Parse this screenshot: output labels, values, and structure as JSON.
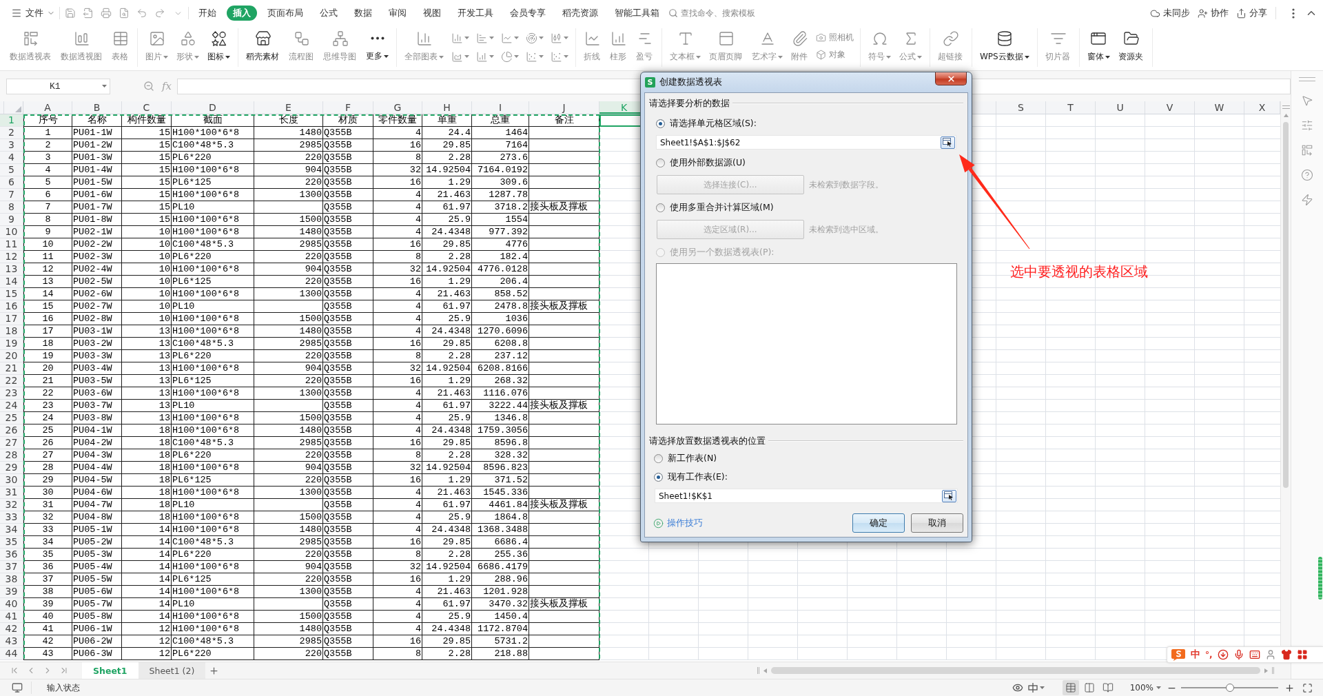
{
  "menu": {
    "file": "文件",
    "tabs": [
      {
        "label": "开始",
        "selected": false
      },
      {
        "label": "插入",
        "selected": true
      },
      {
        "label": "页面布局",
        "selected": false
      },
      {
        "label": "公式",
        "selected": false
      },
      {
        "label": "数据",
        "selected": false
      },
      {
        "label": "审阅",
        "selected": false
      },
      {
        "label": "视图",
        "selected": false
      },
      {
        "label": "开发工具",
        "selected": false
      },
      {
        "label": "会员专享",
        "selected": false
      },
      {
        "label": "稻壳资源",
        "selected": false
      },
      {
        "label": "智能工具箱",
        "selected": false
      }
    ],
    "search": "查找命令、搜索模板",
    "actions": [
      {
        "kind": "sync",
        "label": "未同步"
      },
      {
        "kind": "collaborate",
        "label": "协作"
      },
      {
        "kind": "share",
        "label": "分享"
      }
    ]
  },
  "ribbon": [
    {
      "items": [
        {
          "kind": "large",
          "label": "数据透视表",
          "dropdown": false,
          "disabled": true
        },
        {
          "kind": "large",
          "label": "数据透视图",
          "dropdown": false,
          "disabled": true
        },
        {
          "kind": "large",
          "label": "表格",
          "dropdown": false,
          "disabled": true
        }
      ]
    },
    {
      "items": [
        {
          "kind": "large",
          "label": "图片",
          "dropdown": true,
          "disabled": true
        },
        {
          "kind": "large",
          "label": "形状",
          "dropdown": true,
          "disabled": true
        },
        {
          "kind": "large",
          "label": "图标",
          "dropdown": true,
          "disabled": false
        }
      ]
    },
    {
      "items": [
        {
          "kind": "large",
          "label": "稻壳素材",
          "dropdown": false,
          "disabled": false
        },
        {
          "kind": "large",
          "label": "流程图",
          "dropdown": false,
          "disabled": true
        },
        {
          "kind": "large",
          "label": "思维导图",
          "dropdown": false,
          "disabled": true
        },
        {
          "kind": "large",
          "label": "更多",
          "dropdown": true,
          "disabled": false
        }
      ]
    },
    {
      "items": [
        {
          "kind": "large",
          "label": "全部图表",
          "dropdown": true,
          "disabled": true
        },
        {
          "kind": "grid",
          "buttons": [
            {
              "dropdown": true,
              "disabled": true
            },
            {
              "dropdown": true,
              "disabled": true
            },
            {
              "dropdown": true,
              "disabled": true
            },
            {
              "dropdown": true,
              "disabled": true
            },
            {
              "dropdown": true,
              "disabled": true
            },
            {
              "dropdown": true,
              "disabled": true
            },
            {
              "dropdown": true,
              "disabled": true
            },
            {
              "dropdown": true,
              "disabled": true
            },
            {
              "dropdown": true,
              "disabled": true
            },
            {
              "dropdown": true,
              "disabled": true
            }
          ]
        }
      ]
    },
    {
      "items": [
        {
          "kind": "large",
          "label": "折线",
          "dropdown": false,
          "disabled": true
        },
        {
          "kind": "large",
          "label": "柱形",
          "dropdown": false,
          "disabled": true
        },
        {
          "kind": "large",
          "label": "盈亏",
          "dropdown": false,
          "disabled": true
        }
      ]
    },
    {
      "items": [
        {
          "kind": "large",
          "label": "文本框",
          "dropdown": true,
          "disabled": true
        },
        {
          "kind": "large",
          "label": "页眉页脚",
          "dropdown": false,
          "disabled": true
        },
        {
          "kind": "large",
          "label": "艺术字",
          "dropdown": true,
          "disabled": true
        },
        {
          "kind": "large",
          "label": "附件",
          "dropdown": false,
          "disabled": true
        },
        {
          "kind": "stack",
          "buttons": [
            {
              "label": "照相机",
              "disabled": true
            },
            {
              "label": "对象",
              "disabled": true
            }
          ]
        }
      ]
    },
    {
      "items": [
        {
          "kind": "large",
          "label": "符号",
          "dropdown": true,
          "disabled": true
        },
        {
          "kind": "large",
          "label": "公式",
          "dropdown": true,
          "disabled": true
        }
      ]
    },
    {
      "items": [
        {
          "kind": "large",
          "label": "超链接",
          "dropdown": false,
          "disabled": true
        }
      ]
    },
    {
      "items": [
        {
          "kind": "large",
          "label": "WPS云数据",
          "dropdown": true,
          "disabled": false
        }
      ]
    },
    {
      "items": [
        {
          "kind": "large",
          "label": "切片器",
          "dropdown": false,
          "disabled": true
        }
      ]
    },
    {
      "items": [
        {
          "kind": "large",
          "label": "窗体",
          "dropdown": true,
          "disabled": false
        },
        {
          "kind": "large",
          "label": "资源夹",
          "dropdown": false,
          "disabled": false
        }
      ]
    }
  ],
  "sheet": {
    "name_box": "K1",
    "formula_label": "fx",
    "columns": [
      {
        "label": "A",
        "selected": false
      },
      {
        "label": "B",
        "selected": false
      },
      {
        "label": "C",
        "selected": false
      },
      {
        "label": "D",
        "selected": false
      },
      {
        "label": "E",
        "selected": false
      },
      {
        "label": "F",
        "selected": false
      },
      {
        "label": "G",
        "selected": false
      },
      {
        "label": "H",
        "selected": false
      },
      {
        "label": "I",
        "selected": false
      },
      {
        "label": "J",
        "selected": false
      },
      {
        "label": "K",
        "selected": true
      }
    ],
    "columns_right": [
      {
        "label": "S",
        "selected": false
      },
      {
        "label": "T",
        "selected": false
      },
      {
        "label": "U",
        "selected": false
      },
      {
        "label": "V",
        "selected": false
      },
      {
        "label": "W",
        "selected": false
      },
      {
        "label": "X",
        "selected": false
      }
    ],
    "rows": [
      {
        "number": "1",
        "selected": true,
        "no": "序号",
        "name": "名称",
        "qty": "构件数量",
        "section": "截面",
        "length": "长度",
        "material": "材质",
        "parts": "零件数量",
        "unit_wt": "单重",
        "total_wt": "总重",
        "note": "备注"
      },
      {
        "number": "2",
        "selected": false,
        "no": "1",
        "name": "PU01-1W",
        "qty": "15",
        "section": "H100*100*6*8",
        "length": "1480",
        "material": "Q355B",
        "parts": "4",
        "unit_wt": "24.4",
        "total_wt": "1464"
      },
      {
        "number": "3",
        "selected": false,
        "no": "2",
        "name": "PU01-2W",
        "qty": "15",
        "section": "C100*48*5.3",
        "length": "2985",
        "material": "Q355B",
        "parts": "16",
        "unit_wt": "29.85",
        "total_wt": "7164"
      },
      {
        "number": "4",
        "selected": false,
        "no": "3",
        "name": "PU01-3W",
        "qty": "15",
        "section": "PL6*220",
        "length": "220",
        "material": "Q355B",
        "parts": "8",
        "unit_wt": "2.28",
        "total_wt": "273.6"
      },
      {
        "number": "5",
        "selected": false,
        "no": "4",
        "name": "PU01-4W",
        "qty": "15",
        "section": "H100*100*6*8",
        "length": "904",
        "material": "Q355B",
        "parts": "32",
        "unit_wt": "14.92504",
        "total_wt": "7164.0192"
      },
      {
        "number": "6",
        "selected": false,
        "no": "5",
        "name": "PU01-5W",
        "qty": "15",
        "section": "PL6*125",
        "length": "220",
        "material": "Q355B",
        "parts": "16",
        "unit_wt": "1.29",
        "total_wt": "309.6"
      },
      {
        "number": "7",
        "selected": false,
        "no": "6",
        "name": "PU01-6W",
        "qty": "15",
        "section": "H100*100*6*8",
        "length": "1300",
        "material": "Q355B",
        "parts": "4",
        "unit_wt": "21.463",
        "total_wt": "1287.78"
      },
      {
        "number": "8",
        "selected": false,
        "no": "7",
        "name": "PU01-7W",
        "qty": "15",
        "section": "PL10",
        "material": "Q355B",
        "parts": "4",
        "unit_wt": "61.97",
        "total_wt": "3718.2",
        "note": "接头板及撑板"
      },
      {
        "number": "9",
        "selected": false,
        "no": "8",
        "name": "PU01-8W",
        "qty": "15",
        "section": "H100*100*6*8",
        "length": "1500",
        "material": "Q355B",
        "parts": "4",
        "unit_wt": "25.9",
        "total_wt": "1554"
      },
      {
        "number": "10",
        "selected": false,
        "no": "9",
        "name": "PU02-1W",
        "qty": "10",
        "section": "H100*100*6*8",
        "length": "1480",
        "material": "Q355B",
        "parts": "4",
        "unit_wt": "24.4348",
        "total_wt": "977.392"
      },
      {
        "number": "11",
        "selected": false,
        "no": "10",
        "name": "PU02-2W",
        "qty": "10",
        "section": "C100*48*5.3",
        "length": "2985",
        "material": "Q355B",
        "parts": "16",
        "unit_wt": "29.85",
        "total_wt": "4776"
      },
      {
        "number": "12",
        "selected": false,
        "no": "11",
        "name": "PU02-3W",
        "qty": "10",
        "section": "PL6*220",
        "length": "220",
        "material": "Q355B",
        "parts": "8",
        "unit_wt": "2.28",
        "total_wt": "182.4"
      },
      {
        "number": "13",
        "selected": false,
        "no": "12",
        "name": "PU02-4W",
        "qty": "10",
        "section": "H100*100*6*8",
        "length": "904",
        "material": "Q355B",
        "parts": "32",
        "unit_wt": "14.92504",
        "total_wt": "4776.0128"
      },
      {
        "number": "14",
        "selected": false,
        "no": "13",
        "name": "PU02-5W",
        "qty": "10",
        "section": "PL6*125",
        "length": "220",
        "material": "Q355B",
        "parts": "16",
        "unit_wt": "1.29",
        "total_wt": "206.4"
      },
      {
        "number": "15",
        "selected": false,
        "no": "14",
        "name": "PU02-6W",
        "qty": "10",
        "section": "H100*100*6*8",
        "length": "1300",
        "material": "Q355B",
        "parts": "4",
        "unit_wt": "21.463",
        "total_wt": "858.52"
      },
      {
        "number": "16",
        "selected": false,
        "no": "15",
        "name": "PU02-7W",
        "qty": "10",
        "section": "PL10",
        "material": "Q355B",
        "parts": "4",
        "unit_wt": "61.97",
        "total_wt": "2478.8",
        "note": "接头板及撑板"
      },
      {
        "number": "17",
        "selected": false,
        "no": "16",
        "name": "PU02-8W",
        "qty": "10",
        "section": "H100*100*6*8",
        "length": "1500",
        "material": "Q355B",
        "parts": "4",
        "unit_wt": "25.9",
        "total_wt": "1036"
      },
      {
        "number": "18",
        "selected": false,
        "no": "17",
        "name": "PU03-1W",
        "qty": "13",
        "section": "H100*100*6*8",
        "length": "1480",
        "material": "Q355B",
        "parts": "4",
        "unit_wt": "24.4348",
        "total_wt": "1270.6096"
      },
      {
        "number": "19",
        "selected": false,
        "no": "18",
        "name": "PU03-2W",
        "qty": "13",
        "section": "C100*48*5.3",
        "length": "2985",
        "material": "Q355B",
        "parts": "16",
        "unit_wt": "29.85",
        "total_wt": "6208.8"
      },
      {
        "number": "20",
        "selected": false,
        "no": "19",
        "name": "PU03-3W",
        "qty": "13",
        "section": "PL6*220",
        "length": "220",
        "material": "Q355B",
        "parts": "8",
        "unit_wt": "2.28",
        "total_wt": "237.12"
      },
      {
        "number": "21",
        "selected": false,
        "no": "20",
        "name": "PU03-4W",
        "qty": "13",
        "section": "H100*100*6*8",
        "length": "904",
        "material": "Q355B",
        "parts": "32",
        "unit_wt": "14.92504",
        "total_wt": "6208.8166"
      },
      {
        "number": "22",
        "selected": false,
        "no": "21",
        "name": "PU03-5W",
        "qty": "13",
        "section": "PL6*125",
        "length": "220",
        "material": "Q355B",
        "parts": "16",
        "unit_wt": "1.29",
        "total_wt": "268.32"
      },
      {
        "number": "23",
        "selected": false,
        "no": "22",
        "name": "PU03-6W",
        "qty": "13",
        "section": "H100*100*6*8",
        "length": "1300",
        "material": "Q355B",
        "parts": "4",
        "unit_wt": "21.463",
        "total_wt": "1116.076"
      },
      {
        "number": "24",
        "selected": false,
        "no": "23",
        "name": "PU03-7W",
        "qty": "13",
        "section": "PL10",
        "material": "Q355B",
        "parts": "4",
        "unit_wt": "61.97",
        "total_wt": "3222.44",
        "note": "接头板及撑板"
      },
      {
        "number": "25",
        "selected": false,
        "no": "24",
        "name": "PU03-8W",
        "qty": "13",
        "section": "H100*100*6*8",
        "length": "1500",
        "material": "Q355B",
        "parts": "4",
        "unit_wt": "25.9",
        "total_wt": "1346.8"
      },
      {
        "number": "26",
        "selected": false,
        "no": "25",
        "name": "PU04-1W",
        "qty": "18",
        "section": "H100*100*6*8",
        "length": "1480",
        "material": "Q355B",
        "parts": "4",
        "unit_wt": "24.4348",
        "total_wt": "1759.3056"
      },
      {
        "number": "27",
        "selected": false,
        "no": "26",
        "name": "PU04-2W",
        "qty": "18",
        "section": "C100*48*5.3",
        "length": "2985",
        "material": "Q355B",
        "parts": "16",
        "unit_wt": "29.85",
        "total_wt": "8596.8"
      },
      {
        "number": "28",
        "selected": false,
        "no": "27",
        "name": "PU04-3W",
        "qty": "18",
        "section": "PL6*220",
        "length": "220",
        "material": "Q355B",
        "parts": "8",
        "unit_wt": "2.28",
        "total_wt": "328.32"
      },
      {
        "number": "29",
        "selected": false,
        "no": "28",
        "name": "PU04-4W",
        "qty": "18",
        "section": "H100*100*6*8",
        "length": "904",
        "material": "Q355B",
        "parts": "32",
        "unit_wt": "14.92504",
        "total_wt": "8596.823"
      },
      {
        "number": "30",
        "selected": false,
        "no": "29",
        "name": "PU04-5W",
        "qty": "18",
        "section": "PL6*125",
        "length": "220",
        "material": "Q355B",
        "parts": "16",
        "unit_wt": "1.29",
        "total_wt": "371.52"
      },
      {
        "number": "31",
        "selected": false,
        "no": "30",
        "name": "PU04-6W",
        "qty": "18",
        "section": "H100*100*6*8",
        "length": "1300",
        "material": "Q355B",
        "parts": "4",
        "unit_wt": "21.463",
        "total_wt": "1545.336"
      },
      {
        "number": "32",
        "selected": false,
        "no": "31",
        "name": "PU04-7W",
        "qty": "18",
        "section": "PL10",
        "material": "Q355B",
        "parts": "4",
        "unit_wt": "61.97",
        "total_wt": "4461.84",
        "note": "接头板及撑板"
      },
      {
        "number": "33",
        "selected": false,
        "no": "32",
        "name": "PU04-8W",
        "qty": "18",
        "section": "H100*100*6*8",
        "length": "1500",
        "material": "Q355B",
        "parts": "4",
        "unit_wt": "25.9",
        "total_wt": "1864.8"
      },
      {
        "number": "34",
        "selected": false,
        "no": "33",
        "name": "PU05-1W",
        "qty": "14",
        "section": "H100*100*6*8",
        "length": "1480",
        "material": "Q355B",
        "parts": "4",
        "unit_wt": "24.4348",
        "total_wt": "1368.3488"
      },
      {
        "number": "35",
        "selected": false,
        "no": "34",
        "name": "PU05-2W",
        "qty": "14",
        "section": "C100*48*5.3",
        "length": "2985",
        "material": "Q355B",
        "parts": "16",
        "unit_wt": "29.85",
        "total_wt": "6686.4"
      },
      {
        "number": "36",
        "selected": false,
        "no": "35",
        "name": "PU05-3W",
        "qty": "14",
        "section": "PL6*220",
        "length": "220",
        "material": "Q355B",
        "parts": "8",
        "unit_wt": "2.28",
        "total_wt": "255.36"
      },
      {
        "number": "37",
        "selected": false,
        "no": "36",
        "name": "PU05-4W",
        "qty": "14",
        "section": "H100*100*6*8",
        "length": "904",
        "material": "Q355B",
        "parts": "32",
        "unit_wt": "14.92504",
        "total_wt": "6686.4179"
      },
      {
        "number": "38",
        "selected": false,
        "no": "37",
        "name": "PU05-5W",
        "qty": "14",
        "section": "PL6*125",
        "length": "220",
        "material": "Q355B",
        "parts": "16",
        "unit_wt": "1.29",
        "total_wt": "288.96"
      },
      {
        "number": "39",
        "selected": false,
        "no": "38",
        "name": "PU05-6W",
        "qty": "14",
        "section": "H100*100*6*8",
        "length": "1300",
        "material": "Q355B",
        "parts": "4",
        "unit_wt": "21.463",
        "total_wt": "1201.928"
      },
      {
        "number": "40",
        "selected": false,
        "no": "39",
        "name": "PU05-7W",
        "qty": "14",
        "section": "PL10",
        "material": "Q355B",
        "parts": "4",
        "unit_wt": "61.97",
        "total_wt": "3470.32",
        "note": "接头板及撑板"
      },
      {
        "number": "41",
        "selected": false,
        "no": "40",
        "name": "PU05-8W",
        "qty": "14",
        "section": "H100*100*6*8",
        "length": "1500",
        "material": "Q355B",
        "parts": "4",
        "unit_wt": "25.9",
        "total_wt": "1450.4"
      },
      {
        "number": "42",
        "selected": false,
        "no": "41",
        "name": "PU06-1W",
        "qty": "12",
        "section": "H100*100*6*8",
        "length": "1480",
        "material": "Q355B",
        "parts": "4",
        "unit_wt": "24.4348",
        "total_wt": "1172.8704"
      },
      {
        "number": "43",
        "selected": false,
        "no": "42",
        "name": "PU06-2W",
        "qty": "12",
        "section": "C100*48*5.3",
        "length": "2985",
        "material": "Q355B",
        "parts": "16",
        "unit_wt": "29.85",
        "total_wt": "5731.2"
      },
      {
        "number": "44",
        "selected": false,
        "no": "43",
        "name": "PU06-3W",
        "qty": "12",
        "section": "PL6*220",
        "length": "220",
        "material": "Q355B",
        "parts": "8",
        "unit_wt": "2.28",
        "total_wt": "218.88"
      }
    ]
  },
  "sheet_tabs": [
    {
      "label": "Sheet1",
      "selected": true
    },
    {
      "label": "Sheet1 (2)",
      "selected": false
    }
  ],
  "status_bar": {
    "mode": "输入状态",
    "views": [
      {
        "selected": true
      },
      {
        "selected": false
      },
      {
        "selected": false
      }
    ],
    "zoom": "100%",
    "zoom_slider": {
      "level": 0.5
    }
  },
  "dialog": {
    "logo": "S",
    "title": "创建数据透视表",
    "source_heading": "请选择要分析的数据",
    "source_options": [
      {
        "kind": "range",
        "label": "请选择单元格区域(S):",
        "selected": true,
        "disabled": false,
        "value": "Sheet1!$A$1:$J$62"
      },
      {
        "kind": "external",
        "label": "使用外部数据源(U)",
        "selected": false,
        "disabled": false,
        "button": {
          "label": "选择连接(C)...",
          "disabled": true
        },
        "note": "未检索到数据字段。"
      },
      {
        "kind": "consolidation",
        "label": "使用多重合并计算区域(M)",
        "selected": false,
        "disabled": false,
        "button": {
          "label": "选定区域(R)...",
          "disabled": true
        },
        "note": "未检索到选中区域。"
      },
      {
        "kind": "pivot",
        "label": "使用另一个数据透视表(P):",
        "selected": false,
        "disabled": true
      }
    ],
    "target_heading": "请选择放置数据透视表的位置",
    "target_options": [
      {
        "label": "新工作表(N)",
        "selected": false
      },
      {
        "label": "现有工作表(E):",
        "selected": true,
        "value": "Sheet1!$K$1"
      }
    ],
    "tips_link": "操作技巧",
    "buttons": [
      {
        "kind": "primary",
        "label": "确定"
      },
      {
        "kind": "secondary",
        "label": "取消"
      }
    ]
  },
  "annotation": {
    "text": "选中要透视的表格区域"
  },
  "ime_bar": {
    "mode": "中",
    "punctuation": "°,"
  }
}
